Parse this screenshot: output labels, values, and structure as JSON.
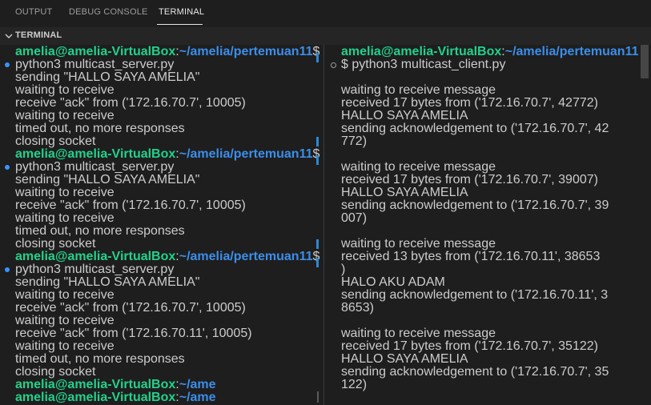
{
  "tabs": [
    "OUTPUT",
    "DEBUG CONSOLE",
    "TERMINAL"
  ],
  "panel_title": "TERMINAL",
  "left_terminal": {
    "prompt_host": "amelia@amelia-VirtualBox",
    "prompt_sep": ":",
    "prompt_path": "~/amelia/pertemuan11",
    "prompt_path_short": "~/ame",
    "prompt_end": "$",
    "lines": [
      "python3 multicast_server.py",
      "sending \"HALLO SAYA AMELIA\"",
      "waiting to receive",
      "receive \"ack\" from ('172.16.70.7', 10005)",
      "waiting to receive",
      "timed out, no more responses",
      "closing socket",
      "python3 multicast_server.py",
      "sending \"HALLO SAYA AMELIA\"",
      "waiting to receive",
      "receive \"ack\" from ('172.16.70.7', 10005)",
      "waiting to receive",
      "timed out, no more responses",
      "closing socket",
      "python3 multicast_server.py",
      "sending \"HALLO SAYA AMELIA\"",
      "waiting to receive",
      "receive \"ack\" from ('172.16.70.7', 10005)",
      "waiting to receive",
      "receive \"ack\" from ('172.16.70.11', 10005)",
      "waiting to receive",
      "timed out, no more responses",
      "closing socket"
    ]
  },
  "right_terminal": {
    "prompt_host": "amelia@amelia-VirtualBox",
    "prompt_sep": ":",
    "prompt_path": "~/amelia/pertemuan11",
    "command": "$ python3 multicast_client.py",
    "lines": [
      "waiting to receive message",
      "received 17 bytes from ('172.16.70.7', 42772)",
      "HALLO SAYA AMELIA",
      "sending acknowledgement to ('172.16.70.7', 42",
      "772)",
      "waiting to receive message",
      "received 17 bytes from ('172.16.70.7', 39007)",
      "HALLO SAYA AMELIA",
      "sending acknowledgement to ('172.16.70.7', 39",
      "007)",
      "waiting to receive message",
      "received 13 bytes from ('172.16.70.11', 38653",
      ")",
      "HALO AKU ADAM",
      "sending acknowledgement to ('172.16.70.11', 3",
      "8653)",
      "waiting to receive message",
      "received 17 bytes from ('172.16.70.7', 35122)",
      "HALLO SAYA AMELIA",
      "sending acknowledgement to ('172.16.70.7', 35",
      "122)"
    ]
  },
  "colors": {
    "background": "#1e1e1e",
    "prompt_host": "#23d18b",
    "prompt_path": "#3b8eea",
    "text": "#cccccc",
    "accent": "#3794ff"
  },
  "icons": [
    "chevron-down-icon",
    "command-decoration-icon"
  ]
}
